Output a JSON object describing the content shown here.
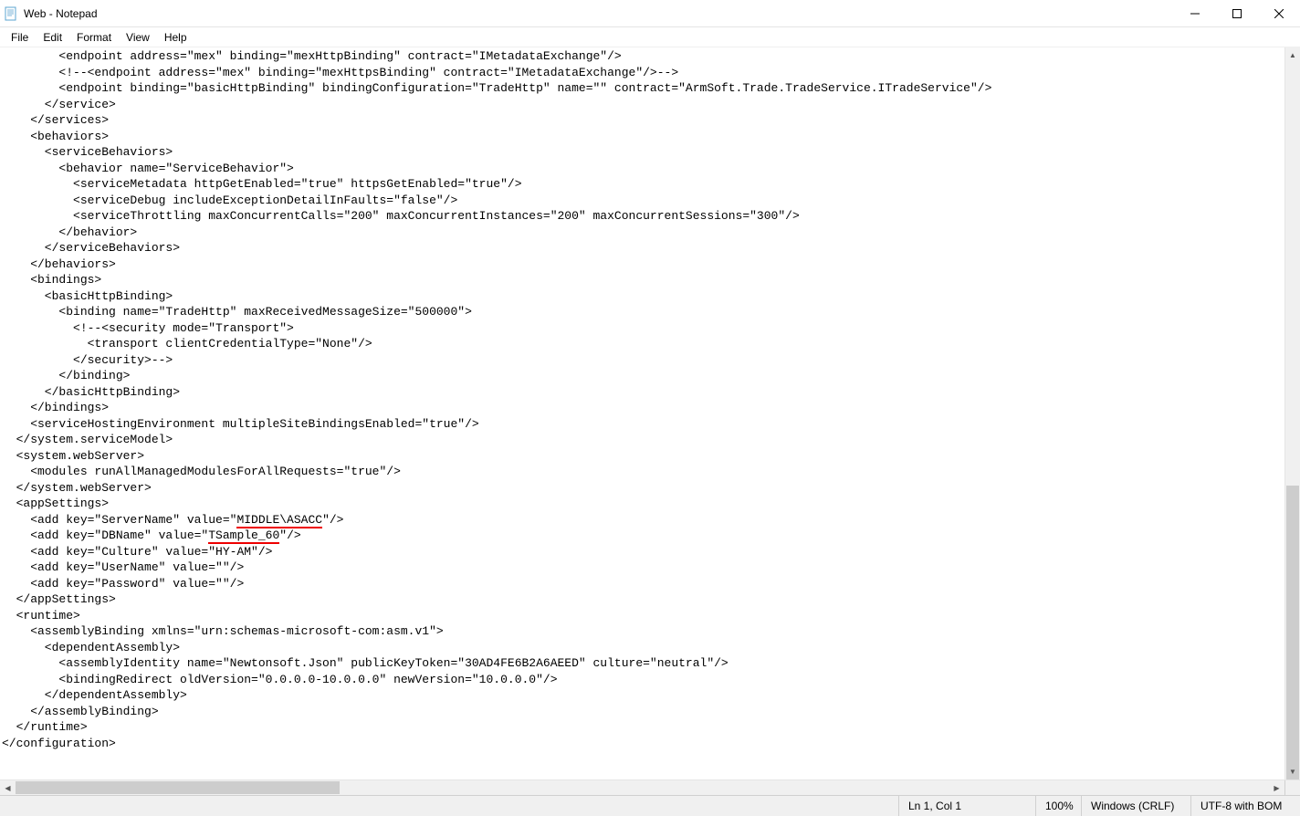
{
  "window": {
    "title": "Web - Notepad"
  },
  "menu": {
    "file": "File",
    "edit": "Edit",
    "format": "Format",
    "view": "View",
    "help": "Help"
  },
  "editor": {
    "lines": [
      "        <endpoint address=\"mex\" binding=\"mexHttpBinding\" contract=\"IMetadataExchange\"/>",
      "        <!--<endpoint address=\"mex\" binding=\"mexHttpsBinding\" contract=\"IMetadataExchange\"/>-->",
      "        <endpoint binding=\"basicHttpBinding\" bindingConfiguration=\"TradeHttp\" name=\"\" contract=\"ArmSoft.Trade.TradeService.ITradeService\"/>",
      "      </service>",
      "    </services>",
      "    <behaviors>",
      "      <serviceBehaviors>",
      "        <behavior name=\"ServiceBehavior\">",
      "          <serviceMetadata httpGetEnabled=\"true\" httpsGetEnabled=\"true\"/>",
      "          <serviceDebug includeExceptionDetailInFaults=\"false\"/>",
      "          <serviceThrottling maxConcurrentCalls=\"200\" maxConcurrentInstances=\"200\" maxConcurrentSessions=\"300\"/>",
      "        </behavior>",
      "      </serviceBehaviors>",
      "    </behaviors>",
      "    <bindings>",
      "      <basicHttpBinding>",
      "        <binding name=\"TradeHttp\" maxReceivedMessageSize=\"500000\">",
      "          <!--<security mode=\"Transport\">",
      "            <transport clientCredentialType=\"None\"/>",
      "          </security>-->",
      "        </binding>",
      "      </basicHttpBinding>",
      "    </bindings>",
      "    <serviceHostingEnvironment multipleSiteBindingsEnabled=\"true\"/>",
      "  </system.serviceModel>",
      "  <system.webServer>",
      "    <modules runAllManagedModulesForAllRequests=\"true\"/>",
      "  </system.webServer>",
      "  <appSettings>",
      "    <add key=\"ServerName\" value=\"",
      "MIDDLE\\ASACC",
      "\"/>",
      "    <add key=\"DBName\" value=\"",
      "TSample_60",
      "\"/>",
      "    <add key=\"Culture\" value=\"HY-AM\"/>",
      "    <add key=\"UserName\" value=\"\"/>",
      "    <add key=\"Password\" value=\"\"/>",
      "  </appSettings>",
      "  <runtime>",
      "    <assemblyBinding xmlns=\"urn:schemas-microsoft-com:asm.v1\">",
      "      <dependentAssembly>",
      "        <assemblyIdentity name=\"Newtonsoft.Json\" publicKeyToken=\"30AD4FE6B2A6AEED\" culture=\"neutral\"/>",
      "        <bindingRedirect oldVersion=\"0.0.0.0-10.0.0.0\" newVersion=\"10.0.0.0\"/>",
      "      </dependentAssembly>",
      "    </assemblyBinding>",
      "  </runtime>",
      "</configuration>"
    ]
  },
  "status": {
    "position": "Ln 1, Col 1",
    "zoom": "100%",
    "lineEnding": "Windows (CRLF)",
    "encoding": "UTF-8 with BOM"
  }
}
